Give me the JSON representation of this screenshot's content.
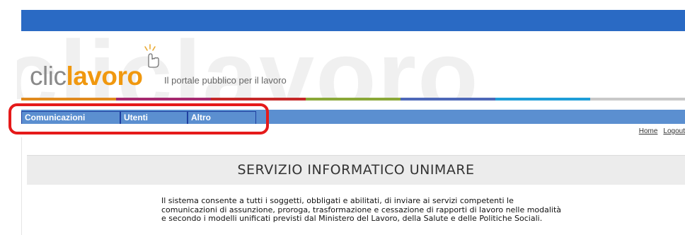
{
  "header": {
    "watermark": "cliclavoro",
    "logo_prefix": "clic",
    "logo_suffix": "lavoro",
    "tagline": "Il portale pubblico per il lavoro",
    "stripe_colors": [
      "#e08a1e",
      "#a52a70",
      "#c52828",
      "#8aa838",
      "#4e68b8",
      "#1e9ed8",
      "#c9c9c9"
    ]
  },
  "menu": {
    "items": [
      {
        "label": "Comunicazioni"
      },
      {
        "label": "Utenti"
      },
      {
        "label": "Altro"
      }
    ]
  },
  "util_links": {
    "home": "Home",
    "logout": "Logout"
  },
  "main": {
    "title": "SERVIZIO INFORMATICO UNIMARE",
    "intro": "Il sistema consente a tutti i soggetti, obbligati e abilitati, di inviare ai servizi competenti le comunicazioni di assunzione, proroga, trasformazione e cessazione di rapporti di lavoro nelle modalità e secondo i modelli unificati previsti dal Ministero del Lavoro, della Salute e delle Politiche Sociali."
  },
  "colors": {
    "top_bar": "#2a6ac4",
    "menu": "#5b8fd0",
    "highlight": "#e51a1a",
    "logo_orange": "#f0980f"
  }
}
